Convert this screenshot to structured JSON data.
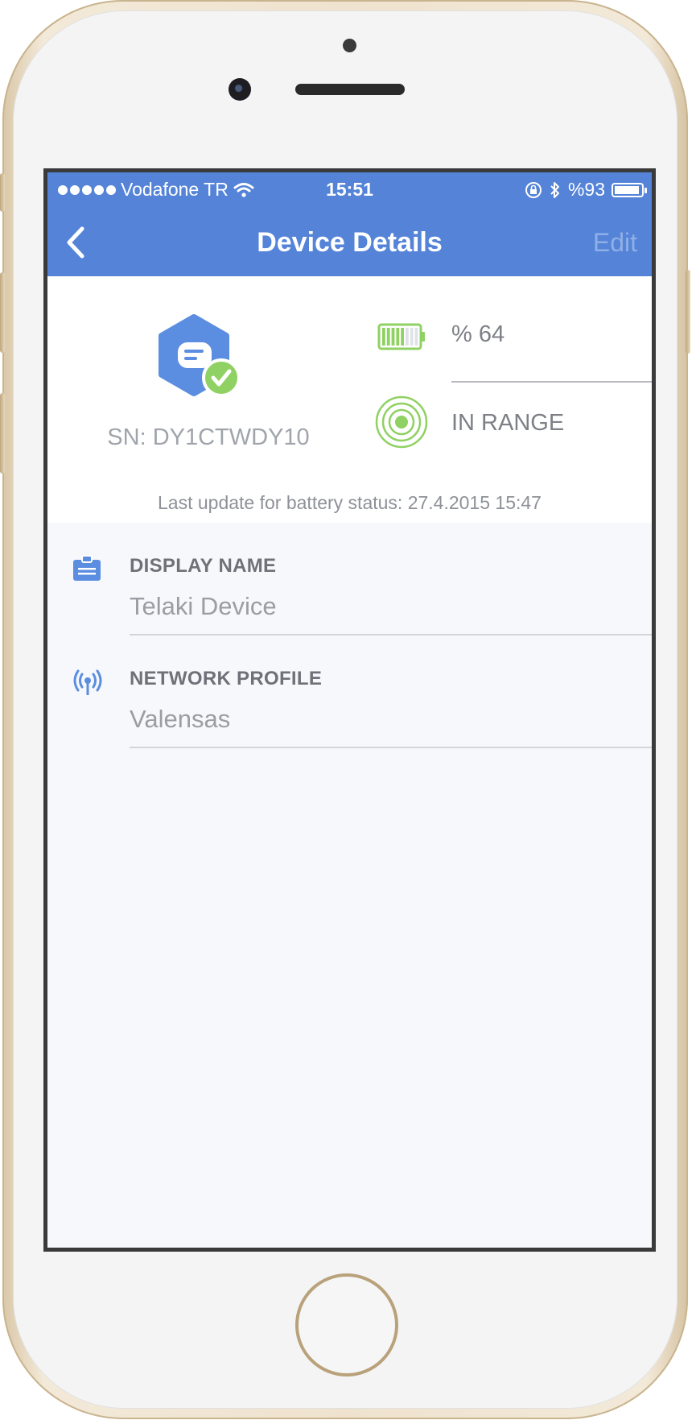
{
  "status_bar": {
    "carrier": "Vodafone TR",
    "time": "15:51",
    "battery_percent": "%93",
    "battery_level": 0.93
  },
  "nav": {
    "title": "Device Details",
    "edit_label": "Edit",
    "back_icon": "chevron-left-icon"
  },
  "device": {
    "serial": "SN: DY1CTWDY10",
    "battery_text": "% 64",
    "battery_level": 0.64,
    "range_status": "IN RANGE",
    "last_update": "Last update for battery status: 27.4.2015 15:47"
  },
  "fields": [
    {
      "icon": "id-card-icon",
      "label": "DISPLAY NAME",
      "value": "Telaki Device"
    },
    {
      "icon": "broadcast-icon",
      "label": "NETWORK PROFILE",
      "value": "Valensas"
    }
  ],
  "colors": {
    "accent": "#5483d8",
    "success": "#8fd162",
    "background": "#f7f8fb"
  }
}
